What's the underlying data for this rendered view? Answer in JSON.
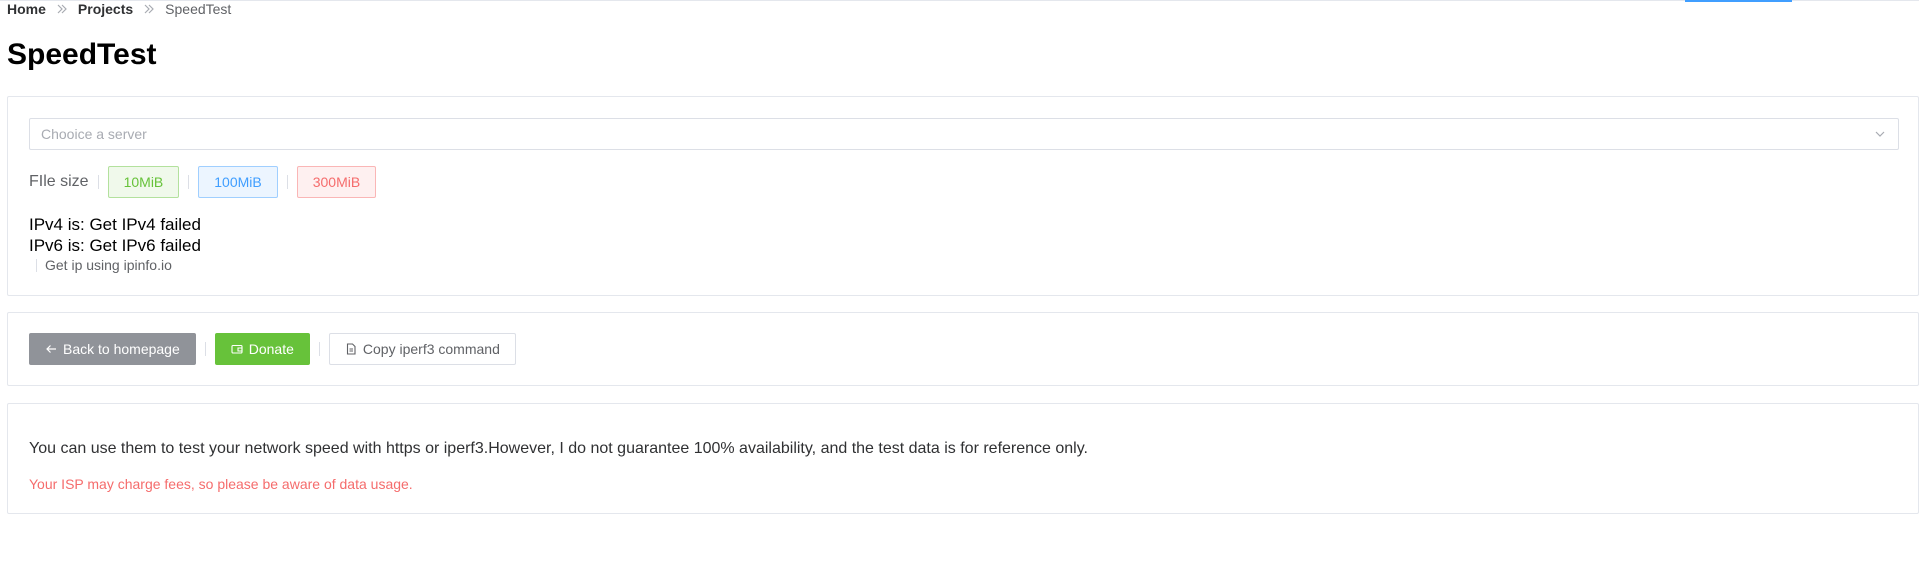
{
  "breadcrumb": {
    "home": "Home",
    "projects": "Projects",
    "current": "SpeedTest"
  },
  "page": {
    "title": "SpeedTest"
  },
  "server_select": {
    "placeholder": "Chooice a server"
  },
  "file_size": {
    "label": "FIle size",
    "options": [
      "10MiB",
      "100MiB",
      "300MiB"
    ]
  },
  "ip": {
    "ipv4": "IPv4 is: Get IPv4 failed",
    "ipv6": "IPv6 is: Get IPv6 failed",
    "source_note": "Get ip using ipinfo.io"
  },
  "actions": {
    "back": "Back to homepage",
    "donate": "Donate",
    "copy": "Copy iperf3 command"
  },
  "notice": {
    "description": "You can use them to test your network speed with https or iperf3.However, I do not guarantee 100% availability, and the test data is for reference only.",
    "warning": "Your ISP may charge fees, so please be aware of data usage."
  },
  "colors": {
    "accent": "#409eff",
    "success": "#67c23a",
    "danger": "#f56c6c",
    "info": "#909399"
  },
  "icons": {
    "breadcrumb_separator": "double-chevron-right-icon",
    "select_arrow": "chevron-down-icon",
    "back": "arrow-left-icon",
    "donate": "wallet-icon",
    "copy": "document-icon"
  }
}
